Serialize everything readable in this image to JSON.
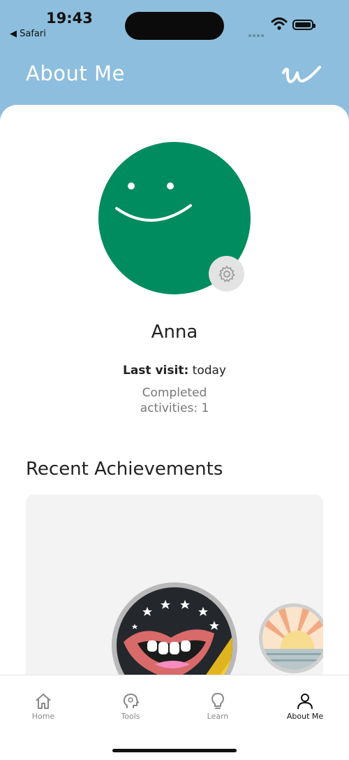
{
  "status_bar": {
    "time": "19:43",
    "back_app": "◀ Safari"
  },
  "header": {
    "title": "About Me",
    "logo_icon": "w-logo-icon"
  },
  "profile": {
    "name": "Anna",
    "last_visit_label": "Last visit:",
    "last_visit_value": "today",
    "completed_line1": "Completed",
    "completed_line2": "activities: 1",
    "avatar_color": "#008c5e"
  },
  "achievements": {
    "title": "Recent Achievements"
  },
  "tabs": [
    {
      "label": "Home",
      "icon": "home-icon",
      "active": false
    },
    {
      "label": "Tools",
      "icon": "head-gear-icon",
      "active": false
    },
    {
      "label": "Learn",
      "icon": "lightbulb-icon",
      "active": false
    },
    {
      "label": "About Me",
      "icon": "person-icon",
      "active": true
    }
  ],
  "colors": {
    "header_bg": "#8dbedd",
    "accent_green": "#008c5e"
  }
}
